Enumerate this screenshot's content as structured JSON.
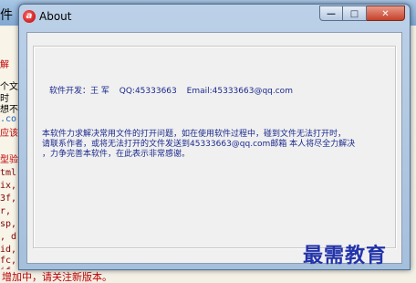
{
  "background_app": {
    "title_fragment": "件",
    "left_lines": [
      {
        "text": "解",
        "style": "cn"
      },
      {
        "text": "个文",
        "style": "black"
      },
      {
        "text": "时",
        "style": "black"
      },
      {
        "text": "想不",
        "style": "black"
      },
      {
        "text": ".co",
        "style": "blue"
      },
      {
        "text": "应该",
        "style": "cn"
      },
      {
        "text": "型验",
        "style": "cn"
      },
      {
        "text": "tml",
        "style": "mono"
      },
      {
        "text": "ix,",
        "style": "mono"
      },
      {
        "text": "3f,",
        "style": "mono"
      },
      {
        "text": "r,",
        "style": "mono"
      },
      {
        "text": "sp,",
        "style": "mono"
      },
      {
        "text": ", d",
        "style": "mono"
      },
      {
        "text": "id,",
        "style": "mono"
      },
      {
        "text": "fc,",
        "style": "mono"
      },
      {
        "text": "if,",
        "style": "mono"
      }
    ],
    "bottom_text": "增加中，请关注新版本。"
  },
  "dialog": {
    "title": "About",
    "icon_letter": "a",
    "buttons": {
      "minimize": "—",
      "maximize": "□",
      "close": "✕"
    },
    "developer_label": "软件开发：王 军",
    "qq": "QQ:45333663",
    "email": "Email:45333663@qq.com",
    "description": "本软件力求解决常用文件的打开问题，如在使用软件过程中，碰到文件无法打开时，\n请联系作者，或将无法打开的文件发送到45333663@qq.com邮箱 本人将尽全力解决\n，力争完善本软件，在此表示非常感谢。"
  },
  "watermark": "最需教育"
}
